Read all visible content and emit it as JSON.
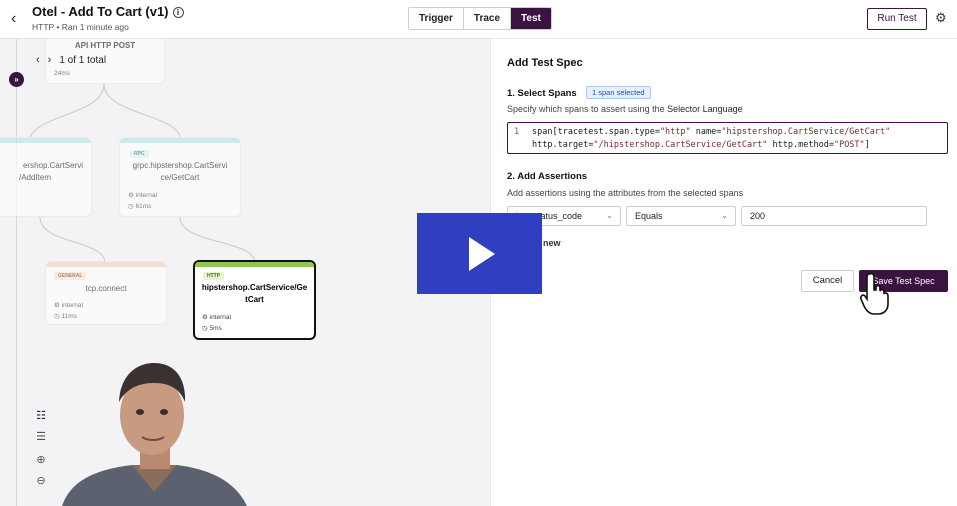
{
  "header": {
    "back_icon": "chevron-left-icon",
    "title": "Otel - Add To Cart (v1)",
    "subtitle": "HTTP • Ran 1 minute ago",
    "tabs": [
      {
        "label": "Trigger",
        "active": false
      },
      {
        "label": "Trace",
        "active": false
      },
      {
        "label": "Test",
        "active": true
      }
    ],
    "run_test_label": "Run Test",
    "settings_icon": "gear-icon",
    "accent_color": "#3b1340"
  },
  "canvas": {
    "pager_text": "1 of 1 total",
    "top_node_label": "API HTTP POST",
    "top_node_meta": "24ms",
    "nodes": [
      {
        "id": "add-item",
        "badge": "",
        "name_line1": "ershop.CartServi",
        "name_line2": "/AddItem",
        "bar_color": "#b7e6e6"
      },
      {
        "id": "get-cart-rpc",
        "badge": "RPC",
        "name_line1": "grpc.hipstershop.CartServi",
        "name_line2": "ce/GetCart",
        "kind": "internal",
        "duration": "61ms",
        "bar_color": "#b7e6e6"
      },
      {
        "id": "tcp-connect",
        "badge": "GENERAL",
        "name_line1": "tcp.connect",
        "kind": "internal",
        "duration": "11ms",
        "bar_color": "#f6d4bd"
      },
      {
        "id": "get-cart-http",
        "badge": "HTTP",
        "name_line1": "hipstershop.CartService/Ge",
        "name_line2": "tCart",
        "kind": "internal",
        "duration": "5ms",
        "bar_color": "#8cc84b",
        "selected": true
      }
    ]
  },
  "panel": {
    "title": "Add Test Spec",
    "select_spans": {
      "heading": "1. Select Spans",
      "badge": "1 span selected",
      "desc_prefix": "Specify which spans to assert using the ",
      "desc_link": "Selector Language",
      "line_no": "1",
      "code_line1_a": "span[tracetest.span.type=",
      "code_line1_b": "\"http\"",
      "code_line1_c": " name=",
      "code_line1_d": "\"hipstershop.CartService/GetCart\"",
      "code_line2_a": "http.target=",
      "code_line2_b": "\"/hipstershop.CartService/GetCart\"",
      "code_line2_c": " http.method=",
      "code_line2_d": "\"POST\"",
      "code_line2_e": "]"
    },
    "assertions": {
      "heading": "2. Add Assertions",
      "desc": "Add assertions using the attributes from the selected spans",
      "attribute_value": "http.status_code",
      "operator_value": "Equals",
      "expected_value": "200",
      "add_new_label": "Add new"
    },
    "cancel_label": "Cancel",
    "save_label": "Save Test Spec"
  },
  "video_overlay": {
    "play_icon": "play-icon",
    "color": "#2f3fbf"
  }
}
